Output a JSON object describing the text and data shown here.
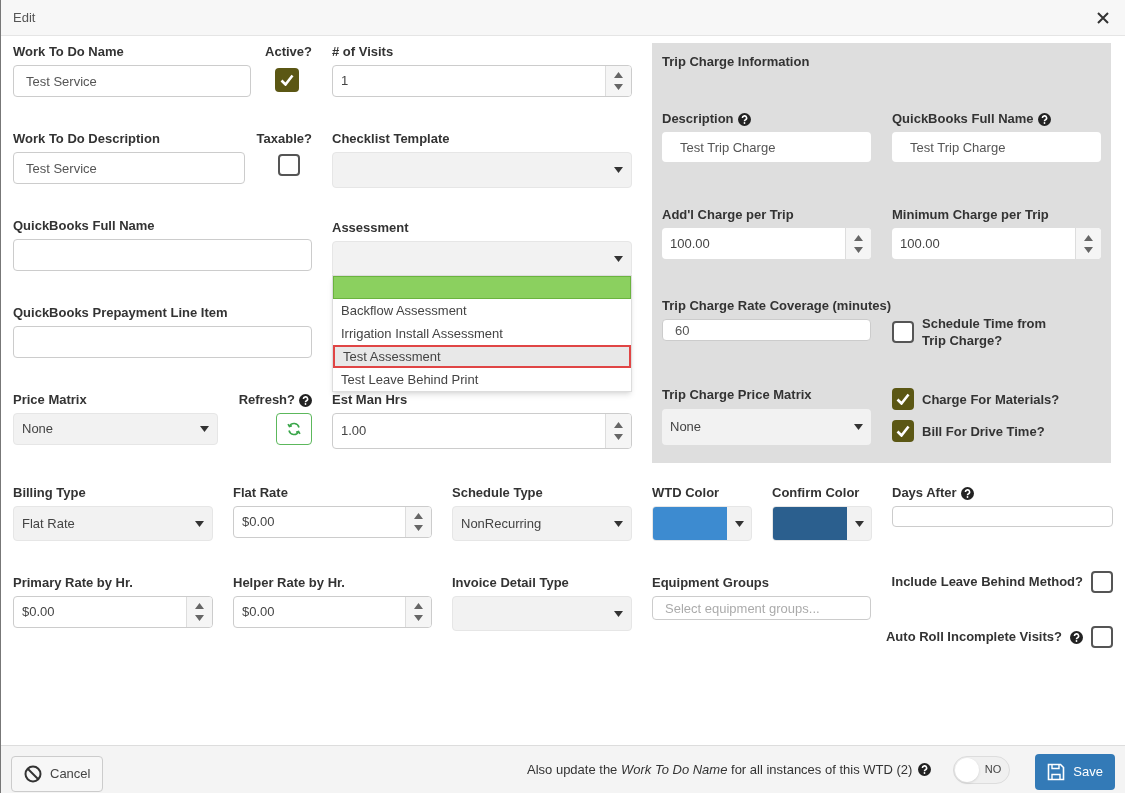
{
  "dialog": {
    "title": "Edit"
  },
  "form": {
    "work_to_do_name": {
      "label": "Work To Do Name",
      "value": "Test Service"
    },
    "active": {
      "label": "Active?",
      "checked": true
    },
    "visits": {
      "label": "# of Visits",
      "value": "1"
    },
    "work_to_do_description": {
      "label": "Work To Do Description",
      "value": "Test Service"
    },
    "taxable": {
      "label": "Taxable?",
      "checked": false
    },
    "checklist_template": {
      "label": "Checklist Template"
    },
    "quickbooks_full_name": {
      "label": "QuickBooks Full Name"
    },
    "assessment": {
      "label": "Assessment",
      "expanded": true,
      "blank_option_selected": true,
      "options": [
        {
          "label": "Backflow Assessment",
          "selected": false,
          "focused": false
        },
        {
          "label": "Irrigation Install Assessment",
          "selected": false,
          "focused": false
        },
        {
          "label": "Test Assessment",
          "selected": false,
          "focused": true
        },
        {
          "label": "Test Leave Behind Print",
          "selected": false,
          "focused": false
        }
      ]
    },
    "quickbooks_prepayment_line_item": {
      "label": "QuickBooks Prepayment Line Item"
    },
    "price_matrix": {
      "label": "Price Matrix",
      "value": "None"
    },
    "refresh": {
      "label": "Refresh?",
      "help": true
    },
    "est_man_hrs": {
      "label": "Est Man Hrs",
      "value": "1.00"
    }
  },
  "trip_charge": {
    "title": "Trip Charge Information",
    "description": {
      "label": "Description",
      "help": true,
      "value": "Test Trip Charge"
    },
    "quickbooks_full_name": {
      "label": "QuickBooks Full Name",
      "help": true,
      "value": "Test Trip Charge"
    },
    "addl_charge_per_trip": {
      "label": "Add'l Charge per Trip",
      "value": "100.00"
    },
    "minimum_charge_per_trip": {
      "label": "Minimum Charge per Trip",
      "value": "100.00"
    },
    "rate_coverage": {
      "label": "Trip Charge Rate Coverage (minutes)",
      "value": "60"
    },
    "schedule_time_from_trip_charge": {
      "label": "Schedule Time from Trip Charge?",
      "checked": false
    },
    "price_matrix": {
      "label": "Trip Charge Price Matrix",
      "value": "None"
    },
    "charge_for_materials": {
      "label": "Charge For Materials?",
      "checked": true
    },
    "bill_for_drive_time": {
      "label": "Bill For Drive Time?",
      "checked": true
    }
  },
  "billing": {
    "billing_type": {
      "label": "Billing Type",
      "value": "Flat Rate"
    },
    "flat_rate": {
      "label": "Flat Rate",
      "value": "$0.00"
    },
    "schedule_type": {
      "label": "Schedule Type",
      "value": "NonRecurring"
    },
    "wtd_color": {
      "label": "WTD Color",
      "color": "#3d8bd0"
    },
    "confirm_color": {
      "label": "Confirm Color",
      "color": "#2b5f8e"
    },
    "days_after": {
      "label": "Days After",
      "help": true
    },
    "primary_rate_by_hr": {
      "label": "Primary Rate by Hr.",
      "value": "$0.00"
    },
    "helper_rate_by_hr": {
      "label": "Helper Rate by Hr.",
      "value": "$0.00"
    },
    "invoice_detail_type": {
      "label": "Invoice Detail Type"
    },
    "equipment_groups": {
      "label": "Equipment Groups",
      "placeholder": "Select equipment groups..."
    },
    "include_leave_behind_method": {
      "label": "Include Leave Behind Method?",
      "checked": false
    },
    "auto_roll_incomplete_visits": {
      "label": "Auto Roll Incomplete Visits?",
      "help": true,
      "checked": false
    }
  },
  "footer": {
    "cancel": "Cancel",
    "update_note": "Also update the *Work To Do Name* for all instances of this WTD (2)",
    "update_help": true,
    "toggle": {
      "label": "NO",
      "on": false
    },
    "save": "Save"
  }
}
